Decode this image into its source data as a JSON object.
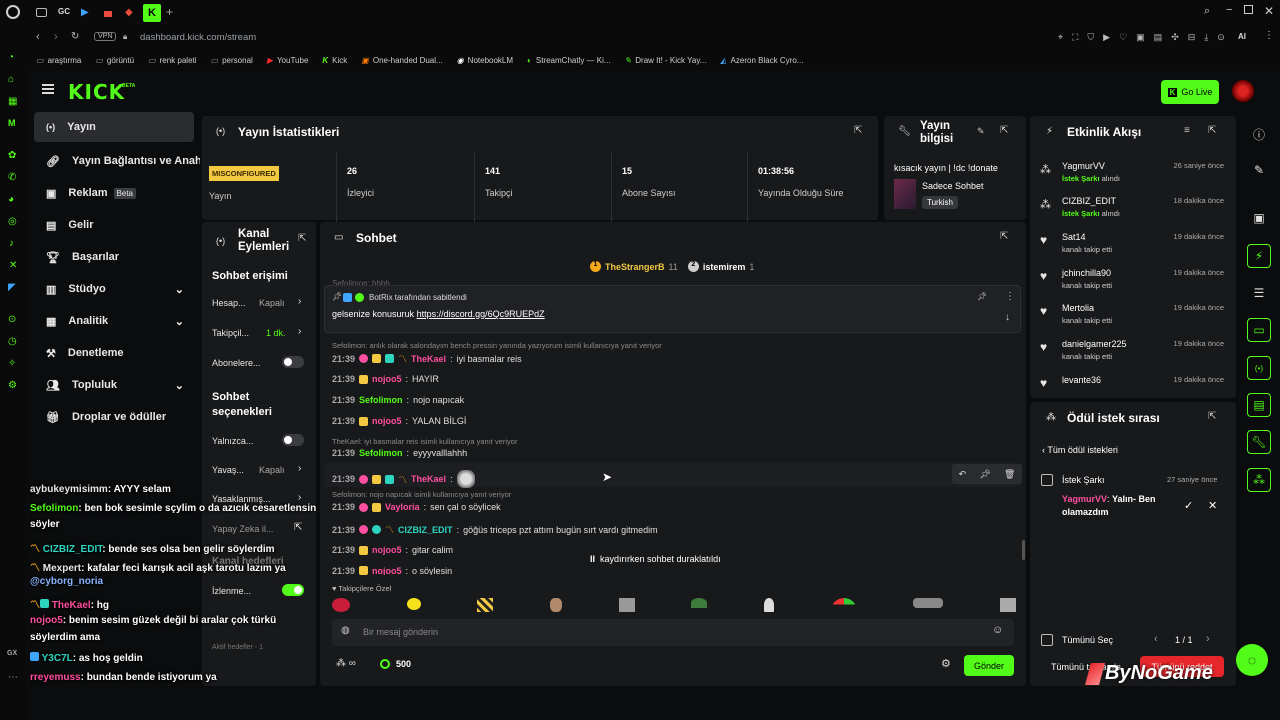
{
  "browser": {
    "url": "dashboard.kick.com/stream",
    "vpn": "VPN",
    "tab_gc": "GC",
    "bookmarks": [
      "araştırma",
      "görüntü",
      "renk paleti",
      "personal",
      "YouTube",
      "Kick",
      "One-handed Dual...",
      "NotebookLM",
      "StreamChatly — Ki...",
      "Draw It! - Kick Yay...",
      "Azeron Black Cyro..."
    ],
    "ai_label": "AI"
  },
  "header": {
    "logo": "KICK",
    "logo_beta": "BETA",
    "go_live": "Go Live"
  },
  "sidebar": {
    "items": [
      {
        "label": "Yayın",
        "icon": "broadcast-icon",
        "active": true
      },
      {
        "label": "Yayın Bağlantısı ve Anahtar",
        "icon": "link-icon"
      },
      {
        "label": "Reklam",
        "icon": "ad-icon",
        "badge": "Beta"
      },
      {
        "label": "Gelir",
        "icon": "revenue-icon"
      },
      {
        "label": "Başarılar",
        "icon": "trophy-icon"
      },
      {
        "label": "Stüdyo",
        "icon": "studio-icon"
      },
      {
        "label": "Analitik",
        "icon": "analytics-icon"
      },
      {
        "label": "Denetleme",
        "icon": "hammer-icon"
      },
      {
        "label": "Topluluk",
        "icon": "community-icon"
      },
      {
        "label": "Droplar ve ödüller",
        "icon": "gift-icon"
      }
    ]
  },
  "stats": {
    "title": "Yayın İstatistikleri",
    "status_badge": "MISCONFIGURED",
    "status_label": "Yayın",
    "viewers": "26",
    "viewers_label": "İzleyici",
    "followers": "141",
    "followers_label": "Takipçi",
    "subs": "15",
    "subs_label": "Abone Sayısı",
    "uptime": "01:38:56",
    "uptime_label": "Yayında Olduğu Süre"
  },
  "stream_info": {
    "title": "Yayın bilgisi",
    "stream_title": "kısacık yayın | !dc !donate",
    "category": "Sadece Sohbet",
    "language": "Turkish"
  },
  "channel_actions": {
    "title": "Kanal Eylemleri",
    "chat_access": "Sohbet erişimi",
    "hesap": "Hesap...",
    "hesap_val": "Kapalı",
    "takipci": "Takipçil...",
    "takipci_val": "1 dk.",
    "abone": "Abonelere...",
    "chat_options": "Sohbet seçenekleri",
    "yalnizca": "Yalnızca...",
    "yavas": "Yavaş...",
    "yavas_val": "Kapalı",
    "yasak": "Yasaklanmış...",
    "yapay": "Yapay Zeka il...",
    "kanal": "Kanal hedefleri",
    "izleme": "İzlenme...",
    "aktif": "Aktif hedefler - 1"
  },
  "chat": {
    "title": "Sohbet",
    "top1_name": "TheStrangerB",
    "top1_count": "11",
    "top2_name": "istemirem",
    "top2_count": "1",
    "faded_top": "Sefolimon: hhhh",
    "pinned_by": "BotRix tarafından sabitlendi",
    "pinned_text": "gelsenize konusuruk",
    "pinned_link": "https://discord.gg/6Qc9RUEPdZ",
    "reply1": "Sefolimon: anlık olarak salondayım bench pressin yanında yazıyorum isimli kullanıcıya yanıt veriyor",
    "reply2": "TheKael: iyi basmalar reis isimli kullanıcıya yanıt veriyor",
    "reply3": "Sefolimon: nojo napıcak isimli kullanıcıya yanıt veriyor",
    "messages": [
      {
        "time": "21:39",
        "user": "TheKael",
        "text": "iyi basmalar reis"
      },
      {
        "time": "21:39",
        "user": "nojoo5",
        "text": "HAYIR"
      },
      {
        "time": "21:39",
        "user": "Sefolimon",
        "text": "nojo napıcak"
      },
      {
        "time": "21:39",
        "user": "nojoo5",
        "text": "YALAN BİLGİ"
      },
      {
        "time": "21:39",
        "user": "Sefolimon",
        "text": "eyyyvalllahhh"
      },
      {
        "time": "21:39",
        "user": "TheKael",
        "text": ""
      },
      {
        "time": "21:39",
        "user": "Vayloria",
        "text": "sen çal o söylicek"
      },
      {
        "time": "21:39",
        "user": "CIZBIZ_EDIT",
        "text": "göğüs triceps pzt attım bugün sırt vardı gitmedim"
      },
      {
        "time": "21:39",
        "user": "nojoo5",
        "text": "gitar calim"
      },
      {
        "time": "21:39",
        "user": "nojoo5",
        "text": "o söylesin"
      }
    ],
    "paused": "kaydırırken sohbet duraklatıldı",
    "follower_emotes": "Takipçilere Özel",
    "input_placeholder": "Bir mesaj gönderin",
    "points": "500",
    "send": "Gönder"
  },
  "events": {
    "title": "Etkinlik Akışı",
    "items": [
      {
        "name": "YagmurVV",
        "pre": "İstek Şarkı",
        "sub": " alındı",
        "time": "26 saniye önce"
      },
      {
        "name": "CIZBIZ_EDIT",
        "pre": "İstek Şarkı",
        "sub": " alındı",
        "time": "18 dakika önce"
      },
      {
        "name": "Sat14",
        "pre": "",
        "sub": "kanalı takip etti",
        "time": "19 dakika önce"
      },
      {
        "name": "jchinchilla90",
        "pre": "",
        "sub": "kanalı takip etti",
        "time": "19 dakika önce"
      },
      {
        "name": "Mertolia",
        "pre": "",
        "sub": "kanalı takip etti",
        "time": "19 dakika önce"
      },
      {
        "name": "danielgamer225",
        "pre": "",
        "sub": "kanalı takip etti",
        "time": "19 dakika önce"
      },
      {
        "name": "levante36",
        "pre": "",
        "sub": "",
        "time": "19 dakika önce"
      }
    ]
  },
  "rewards": {
    "title": "Ödül istek sırası",
    "back": "Tüm ödül istekleri",
    "item_title": "İstek Şarkı",
    "item_time": "27 saniye önce",
    "item_user": "YagmurVV",
    "item_text": "Yalın- Ben olamazdım",
    "select_all": "Tümünü Seç",
    "pages": "1 / 1",
    "approve_all": "Tümünü tamamla",
    "reject_all": "Tümünü reddet"
  },
  "overlay_chat": [
    {
      "user": "aybukeymisimm",
      "text": ": AYYY selam",
      "color": "#e8e8e8"
    },
    {
      "user": "Sefolimon",
      "text": ": ben bok sesimle sçylim o da azıcık cesaretlensin",
      "color": "#53fc18"
    },
    {
      "user": "",
      "text": "söyler",
      "color": "#fff"
    },
    {
      "user": "CIZBIZ_EDIT",
      "text": ": bende ses olsa ben gelir söylerdim",
      "color": "#2dd4bf"
    },
    {
      "user": "Mexpert",
      "text": ": kafalar feci karışık acil aşk tarotu lazım ya",
      "color": "#e8e8e8"
    },
    {
      "user": "",
      "text": "@cyborg_noria",
      "color": "#8ab4ff"
    },
    {
      "user": "TheKael",
      "text": ": hg",
      "color": "#ff4fa0"
    },
    {
      "user": "nojoo5",
      "text": ": benim sesim güzek değil bi aralar çok türkü",
      "color": "#ff4fa0"
    },
    {
      "user": "",
      "text": "söylerdim ama",
      "color": "#fff"
    },
    {
      "user": "Y3C7L",
      "text": ": as hoş geldin",
      "color": "#2dd4bf"
    },
    {
      "user": "rreyemuss",
      "text": ": bundan bende istiyorum ya",
      "color": "#ff4fa0"
    }
  ],
  "watermark": "ByNoGame",
  "colors": {
    "accent": "#53fc18",
    "panel": "#18191b",
    "bg": "#0b0c0d"
  }
}
